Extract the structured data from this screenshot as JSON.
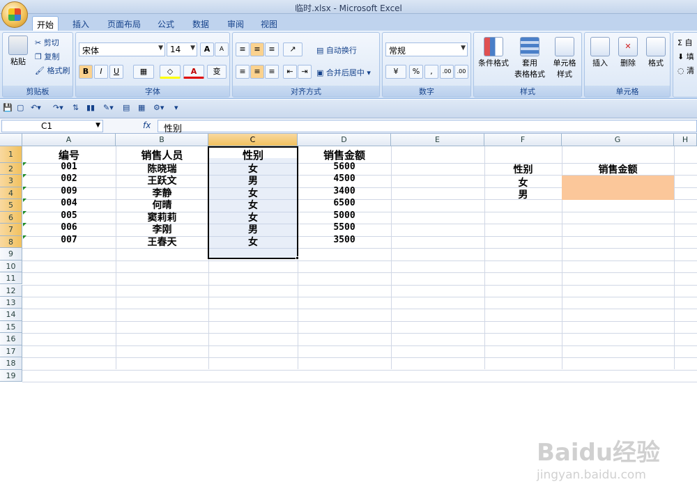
{
  "window": {
    "title": "临时.xlsx - Microsoft Excel"
  },
  "tabs": [
    "开始",
    "插入",
    "页面布局",
    "公式",
    "数据",
    "审阅",
    "视图"
  ],
  "ribbon": {
    "clipboard": {
      "paste": "粘贴",
      "cut": "剪切",
      "copy": "复制",
      "format_painter": "格式刷",
      "label": "剪贴板"
    },
    "font": {
      "name": "宋体",
      "size": "14",
      "grow": "A",
      "shrink": "A",
      "bold": "B",
      "italic": "I",
      "underline": "U",
      "font_color": "A",
      "phonetic": "变",
      "label": "字体"
    },
    "alignment": {
      "wrap": "自动换行",
      "merge": "合并后居中",
      "label": "对齐方式"
    },
    "number": {
      "format": "常规",
      "percent": "%",
      "comma": ",",
      "inc": ".00",
      "dec": ".00",
      "label": "数字"
    },
    "styles": {
      "conditional": "条件格式",
      "table_line1": "套用",
      "table_line2": "表格格式",
      "cell_line1": "单元格",
      "cell_line2": "样式",
      "label": "样式"
    },
    "cells": {
      "insert": "插入",
      "delete": "删除",
      "format": "格式",
      "label": "单元格"
    },
    "editing": {
      "autosum": "自",
      "fill": "填",
      "clear": "清"
    }
  },
  "formula_bar": {
    "name_box": "C1",
    "fx": "fx",
    "content": "性别"
  },
  "columns": [
    "A",
    "B",
    "C",
    "D",
    "E",
    "F",
    "G",
    "H"
  ],
  "rows": [
    "1",
    "2",
    "3",
    "4",
    "5",
    "6",
    "7",
    "8",
    "9",
    "10",
    "11",
    "12",
    "13",
    "14",
    "15",
    "16",
    "17",
    "18",
    "19"
  ],
  "headers": {
    "a": "编号",
    "b": "销售人员",
    "c": "性别",
    "d": "销售金额"
  },
  "records": [
    {
      "id": "001",
      "name": "陈晓瑞",
      "gender": "女",
      "amount": "5600"
    },
    {
      "id": "002",
      "name": "王跃文",
      "gender": "男",
      "amount": "4500"
    },
    {
      "id": "009",
      "name": "李静",
      "gender": "女",
      "amount": "3400"
    },
    {
      "id": "004",
      "name": "何晴",
      "gender": "女",
      "amount": "6500"
    },
    {
      "id": "005",
      "name": "窦莉莉",
      "gender": "女",
      "amount": "5000"
    },
    {
      "id": "006",
      "name": "李刚",
      "gender": "男",
      "amount": "5500"
    },
    {
      "id": "007",
      "name": "王春天",
      "gender": "女",
      "amount": "3500"
    }
  ],
  "summary": {
    "f_header": "性别",
    "g_header": "销售金额",
    "f3": "女",
    "f4": "男"
  },
  "watermark": {
    "line1": "Baidu经验",
    "line2": "jingyan.baidu.com"
  },
  "colors": {
    "accent": "#f1c15f",
    "highlight": "#fbc79a",
    "grid": "#d0d7e5"
  }
}
